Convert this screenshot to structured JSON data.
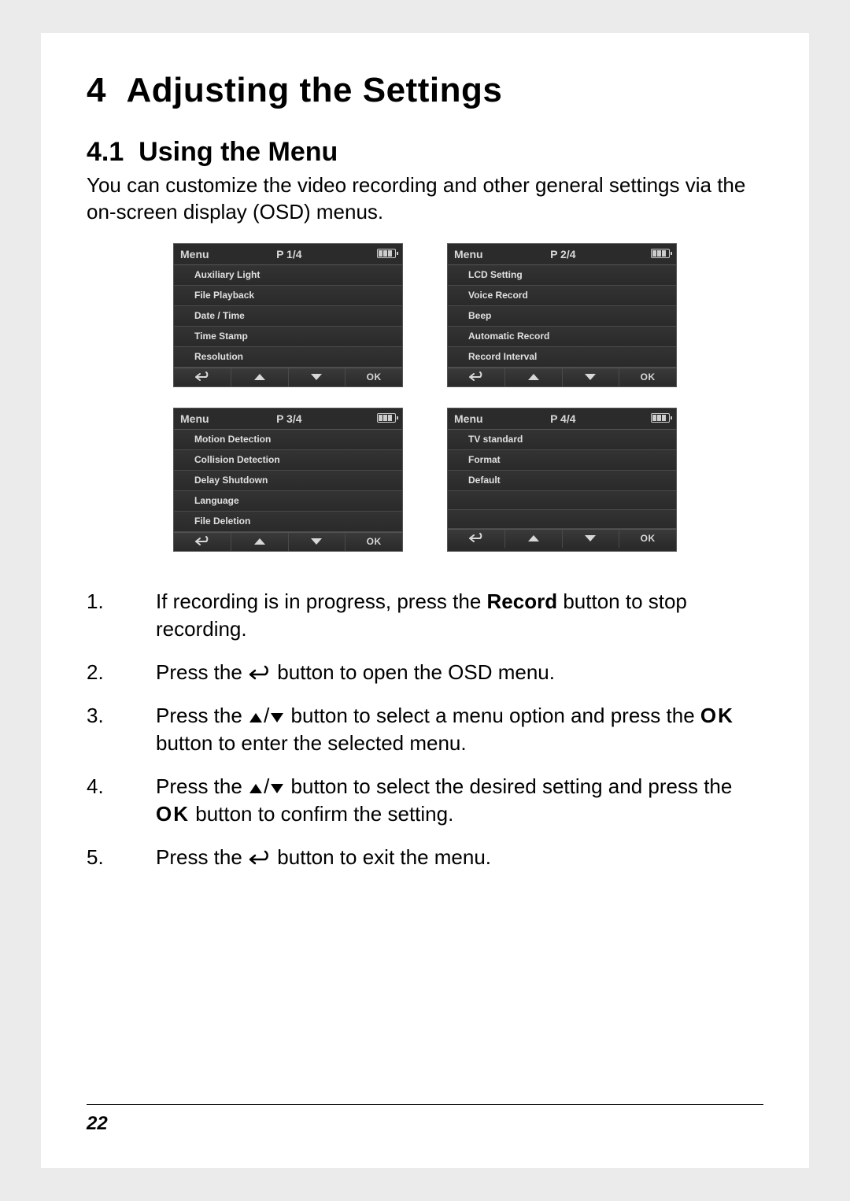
{
  "chapter": {
    "num": "4",
    "title": "Adjusting the Settings"
  },
  "section": {
    "num": "4.1",
    "title": "Using the Menu"
  },
  "intro": "You can customize the video recording and other general settings via the on-screen display (OSD) menus.",
  "menus": [
    {
      "title": "Menu",
      "page": "P 1/4",
      "items": [
        "Auxiliary Light",
        "File Playback",
        "Date / Time",
        "Time Stamp",
        "Resolution"
      ],
      "nav": {
        "back": "back-icon",
        "up": "up-icon",
        "down": "down-icon",
        "ok": "OK"
      }
    },
    {
      "title": "Menu",
      "page": "P 2/4",
      "items": [
        "LCD Setting",
        "Voice Record",
        "Beep",
        "Automatic Record",
        "Record Interval"
      ],
      "nav": {
        "back": "back-icon",
        "up": "up-icon",
        "down": "down-icon",
        "ok": "OK"
      }
    },
    {
      "title": "Menu",
      "page": "P 3/4",
      "items": [
        "Motion Detection",
        "Collision Detection",
        "Delay Shutdown",
        "Language",
        "File Deletion"
      ],
      "nav": {
        "back": "back-icon",
        "up": "up-icon",
        "down": "down-icon",
        "ok": "OK"
      }
    },
    {
      "title": "Menu",
      "page": "P 4/4",
      "items": [
        "TV standard",
        "Format",
        "Default",
        "",
        ""
      ],
      "nav": {
        "back": "back-icon",
        "up": "up-icon",
        "down": "down-icon",
        "ok": "OK"
      }
    }
  ],
  "steps": {
    "s1a": "If recording is in progress, press the ",
    "s1b": "Record",
    "s1c": " button to stop recording.",
    "s2a": "Press the ",
    "s2b": " button to open the OSD menu.",
    "s3a": "Press the ",
    "s3b": " button to select a menu option and press the ",
    "s3c": " button to enter the selected menu.",
    "s4a": "Press the ",
    "s4b": " button to select the desired setting and press the ",
    "s4c": " button to confirm the setting.",
    "s5a": "Press the ",
    "s5b": " button to exit the menu."
  },
  "icons": {
    "ok_text": "OK"
  },
  "page_number": "22"
}
